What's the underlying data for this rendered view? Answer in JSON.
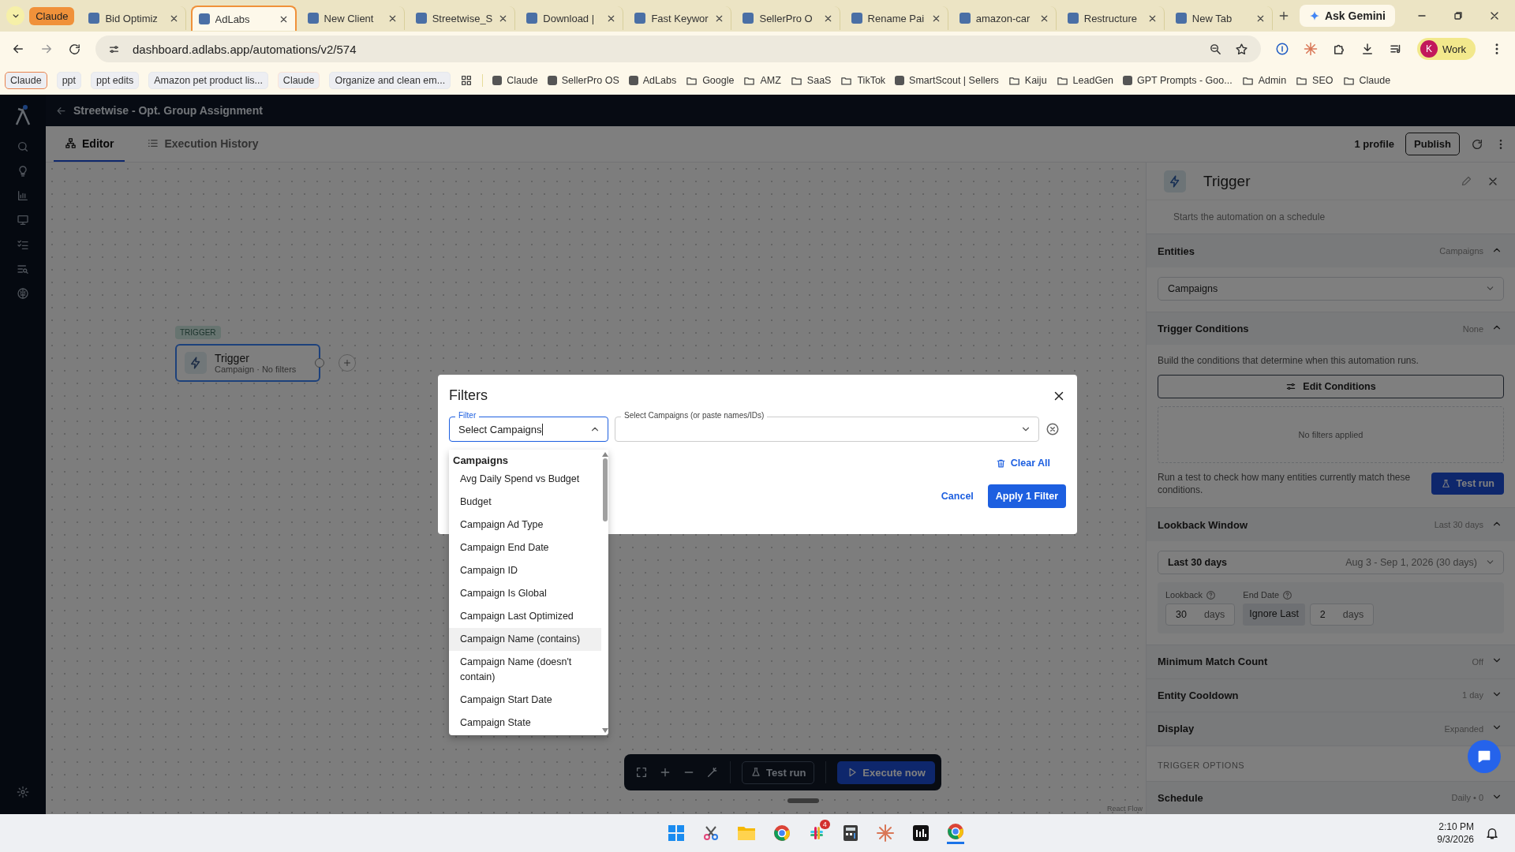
{
  "browser": {
    "tab_group": {
      "label": "Claude",
      "color": "#f0913a"
    },
    "tabs": [
      {
        "label": "Bid Optimiz",
        "selected": false
      },
      {
        "label": "AdLabs",
        "selected": true
      },
      {
        "label": "New Client",
        "selected": false
      },
      {
        "label": "Streetwise_S",
        "selected": false
      },
      {
        "label": "Download |",
        "selected": false
      },
      {
        "label": "Fast Keywor",
        "selected": false
      },
      {
        "label": "SellerPro O",
        "selected": false
      },
      {
        "label": "Rename Pai",
        "selected": false
      },
      {
        "label": "amazon-car",
        "selected": false
      },
      {
        "label": "Restructure",
        "selected": false
      },
      {
        "label": "New Tab",
        "selected": false
      }
    ],
    "ask_gemini": "Ask Gemini",
    "url": "dashboard.adlabs.app/automations/v2/574",
    "profile": {
      "initial": "K",
      "label": "Work"
    },
    "bookmarks": [
      {
        "label": "Claude",
        "kind": "group",
        "color": "#e8834f"
      },
      {
        "label": "ppt",
        "kind": "group",
        "color": "#e6e8ec"
      },
      {
        "label": "ppt edits",
        "kind": "group",
        "color": "#e6e8ec"
      },
      {
        "label": "Amazon pet product lis...",
        "kind": "group",
        "color": "#e6e8ec"
      },
      {
        "label": "Claude",
        "kind": "group",
        "color": "#fbe4d8"
      },
      {
        "label": "Organize and clean em...",
        "kind": "group",
        "color": "#e6e8ec"
      },
      {
        "kind": "apps"
      },
      {
        "label": "Claude",
        "kind": "site"
      },
      {
        "label": "SellerPro OS",
        "kind": "site"
      },
      {
        "label": "AdLabs",
        "kind": "site"
      },
      {
        "label": "Google",
        "kind": "folder"
      },
      {
        "label": "AMZ",
        "kind": "folder"
      },
      {
        "label": "SaaS",
        "kind": "folder"
      },
      {
        "label": "TikTok",
        "kind": "folder"
      },
      {
        "label": "SmartScout | Sellers",
        "kind": "site"
      },
      {
        "label": "Kaiju",
        "kind": "folder"
      },
      {
        "label": "LeadGen",
        "kind": "folder"
      },
      {
        "label": "GPT Prompts - Goo...",
        "kind": "site"
      },
      {
        "label": "Admin",
        "kind": "folder"
      },
      {
        "label": "SEO",
        "kind": "folder"
      },
      {
        "label": "Claude",
        "kind": "folder"
      }
    ]
  },
  "app": {
    "title": "Streetwise - Opt. Group Assignment",
    "tabs": [
      {
        "label": "Editor",
        "selected": true
      },
      {
        "label": "Execution History",
        "selected": false
      }
    ],
    "profile_count": "1 profile",
    "publish": "Publish",
    "node": {
      "tag": "TRIGGER",
      "title": "Trigger",
      "subtitle": "Campaign · No filters"
    },
    "toolbar": {
      "test_run": "Test run",
      "execute": "Execute now"
    },
    "attribution": "React Flow"
  },
  "panel": {
    "title": "Trigger",
    "description": "Starts the automation on a schedule",
    "sections": [
      {
        "kind": "entities",
        "title": "Entities",
        "value": "Campaigns",
        "expanded": true,
        "select": "Campaigns"
      },
      {
        "kind": "conditions",
        "title": "Trigger Conditions",
        "value": "None",
        "expanded": true,
        "text": "Build the conditions that determine when this automation runs.",
        "button": "Edit Conditions",
        "empty": "No filters applied",
        "test_text": "Run a test to check how many entities currently match these conditions.",
        "test_button": "Test run"
      },
      {
        "kind": "lookback",
        "title": "Lookback Window",
        "value": "Last 30 days",
        "expanded": true,
        "select": "Last 30 days",
        "range": "Aug 3 - Sep 1, 2026 (30 days)",
        "lookback_label": "Lookback",
        "lookback": "30",
        "unit": "days",
        "end_label": "End Date",
        "end_mode": "Ignore Last",
        "end_value": "2",
        "end_unit": "days"
      },
      {
        "kind": "plain",
        "title": "Minimum Match Count",
        "value": "Off",
        "expanded": false
      },
      {
        "kind": "plain",
        "title": "Entity Cooldown",
        "value": "1 day",
        "expanded": false
      },
      {
        "kind": "plain",
        "title": "Display",
        "value": "Expanded",
        "expanded": false
      },
      {
        "kind": "heading",
        "title": "TRIGGER OPTIONS"
      },
      {
        "kind": "plain",
        "title": "Schedule",
        "value": "Daily • 0",
        "expanded": false
      }
    ]
  },
  "modal": {
    "title": "Filters",
    "filter_label": "Filter",
    "filter_value": "Select Campaigns",
    "select_label": "Select Campaigns (or paste names/IDs)",
    "clear_all": "Clear All",
    "cancel": "Cancel",
    "apply": "Apply 1 Filter",
    "group": "Campaigns",
    "options": [
      {
        "label": "Avg Daily Spend vs Budget",
        "selected": false
      },
      {
        "label": "Budget",
        "selected": false
      },
      {
        "label": "Campaign Ad Type",
        "selected": false
      },
      {
        "label": "Campaign End Date",
        "selected": false
      },
      {
        "label": "Campaign ID",
        "selected": false
      },
      {
        "label": "Campaign Is Global",
        "selected": false
      },
      {
        "label": "Campaign Last Optimized",
        "selected": false
      },
      {
        "label": "Campaign Name (contains)",
        "selected": true
      },
      {
        "label": "Campaign Name (doesn't contain)",
        "selected": false
      },
      {
        "label": "Campaign Start Date",
        "selected": false
      },
      {
        "label": "Campaign State",
        "selected": false
      }
    ]
  },
  "taskbar": {
    "badge": "4",
    "time": "2:10 PM",
    "date": "9/3/2026"
  }
}
